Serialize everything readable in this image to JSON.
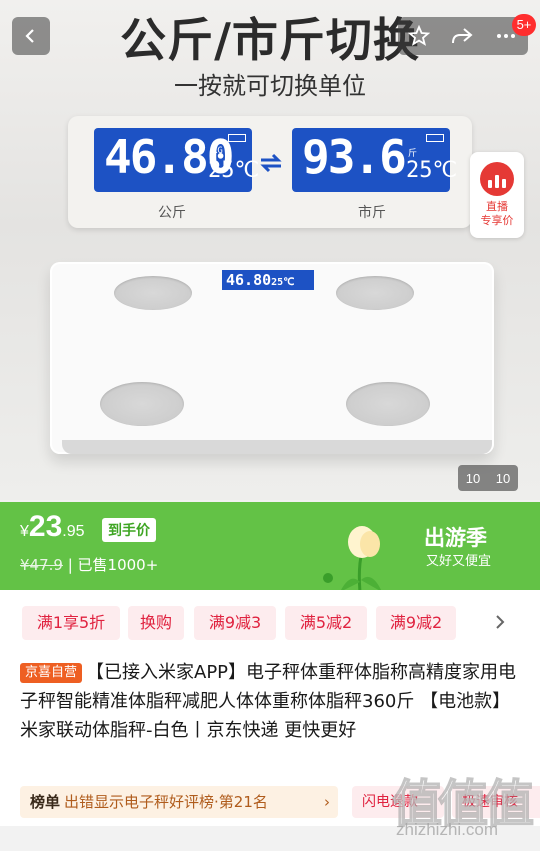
{
  "hero": {
    "title": "公斤/市斤切换",
    "subtitle": "一按就可切换单位",
    "left_lcd": {
      "value": "46.80",
      "unit": "KG",
      "temp": "25℃"
    },
    "right_lcd": {
      "value": "93.6",
      "unit": "斤",
      "temp": "25℃"
    },
    "left_label": "公斤",
    "right_label": "市斤",
    "mini_lcd": "46.80",
    "mini_temp": "25℃",
    "image_counter": [
      "10",
      "10"
    ]
  },
  "topbar": {
    "badge": "5+"
  },
  "live": {
    "line1": "直播",
    "line2": "专享价"
  },
  "price": {
    "currency": "¥",
    "integer": "23",
    "decimal": ".95",
    "tag": "到手价",
    "original": "¥47.9",
    "sold": "| 已售1000+"
  },
  "promo": {
    "title": "出游季",
    "subtitle": "又好又便宜"
  },
  "coupons": [
    "满1享5折",
    "换购",
    "满9减3",
    "满5减2",
    "满9减2"
  ],
  "product": {
    "store_tag": "京喜自营",
    "title": "【已接入米家APP】电子秤体重秤体脂称高精度家用电子秤智能精准体脂秤减肥人体体重称体脂秤360斤 【电池款】米家联动体脂秤-白色丨京东快递 更快更好"
  },
  "rank": {
    "label": "榜单",
    "text": "出错显示电子秤好评榜·第21名",
    "arrow": "›"
  },
  "flash": [
    "闪电退款",
    "极速审核"
  ],
  "watermark": {
    "text": "值值值",
    "url": "zhizhizhi.com"
  },
  "colors": {
    "green": "#63c246",
    "red": "#e0223f",
    "lcd_blue": "#1d52c4"
  }
}
